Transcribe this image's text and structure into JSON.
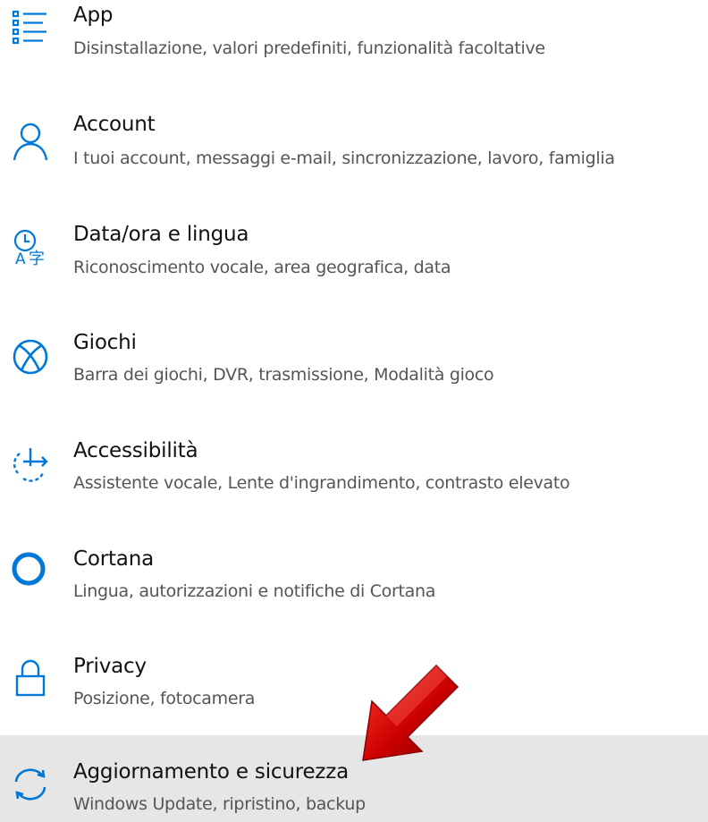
{
  "accent_color": "#0078d7",
  "settings_list": {
    "items": [
      {
        "title": "App",
        "description": "Disinstallazione, valori predefiniti, funzionalità facoltative",
        "icon": "apps-list-icon"
      },
      {
        "title": "Account",
        "description": "I tuoi account, messaggi e-mail, sincronizzazione, lavoro, famiglia",
        "icon": "person-icon"
      },
      {
        "title": "Data/ora e lingua",
        "description": "Riconoscimento vocale, area geografica, data",
        "icon": "time-language-icon"
      },
      {
        "title": "Giochi",
        "description": "Barra dei giochi, DVR, trasmissione, Modalità gioco",
        "icon": "xbox-icon"
      },
      {
        "title": "Accessibilità",
        "description": "Assistente vocale, Lente d'ingrandimento, contrasto elevato",
        "icon": "ease-of-access-icon"
      },
      {
        "title": "Cortana",
        "description": "Lingua, autorizzazioni e notifiche di Cortana",
        "icon": "cortana-circle-icon"
      },
      {
        "title": "Privacy",
        "description": "Posizione, fotocamera",
        "icon": "lock-icon"
      },
      {
        "title": "Aggiornamento e sicurezza",
        "description": "Windows Update, ripristino, backup",
        "icon": "sync-icon",
        "selected": true
      }
    ]
  },
  "annotation": {
    "icon": "red-pointer-arrow-icon",
    "color": "#cc0000"
  }
}
